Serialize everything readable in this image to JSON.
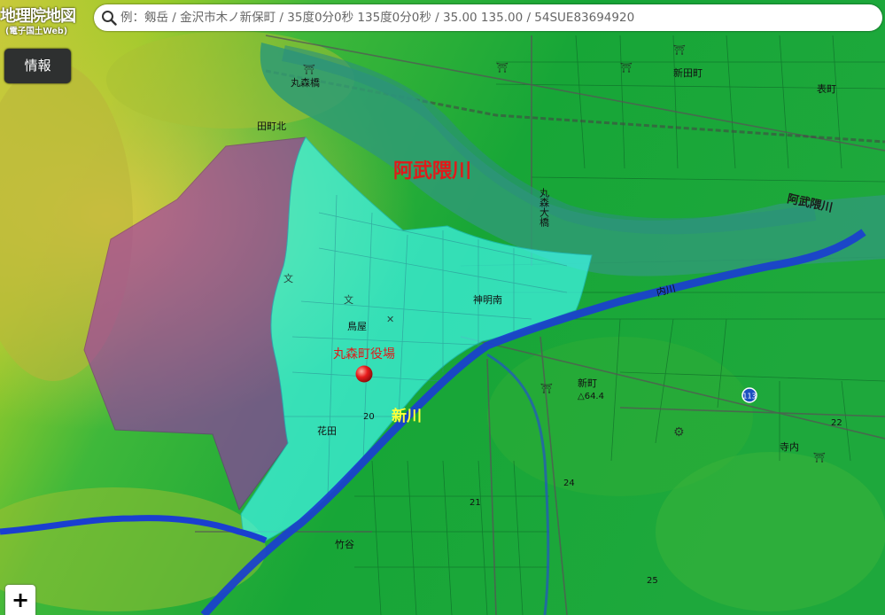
{
  "header": {
    "logo_main": "地理院地図",
    "logo_sub": "(電子国土Web)",
    "search_placeholder": "例：剱岳 / 金沢市木ノ新保町 / 35度0分0秒 135度0分0秒 / 35.00 135.00 / 54SUE83694920"
  },
  "controls": {
    "info_label": "情報",
    "zoom_in_label": "+"
  },
  "map": {
    "labels": {
      "river_large": "阿武隈川",
      "river_small": "阿武隈川",
      "office": "丸森町役場",
      "shinkawa": "新川",
      "uchikawa": "内川",
      "marumori_bridge": "丸森橋",
      "marumori_ohashi": "丸森大橋",
      "shinden": "新田町",
      "omote": "表町",
      "jinmei": "神明南",
      "torii": "鳥屋",
      "hanada": "花田",
      "takeya": "竹谷",
      "shinmachi": "新町",
      "terauchi": "寺内",
      "tamachi": "田町北",
      "height_main": "64.4",
      "n22": "22",
      "n24": "24",
      "n25": "25",
      "n20": "20",
      "n21": "21",
      "route": "113"
    },
    "colors": {
      "river": "#1a3fd0",
      "purple_zone": "#a02ab4",
      "cyan_zone": "#3ff5e8",
      "office_marker": "#e81b1b",
      "label_red": "#e01a1a",
      "label_yellow": "#ffff3a"
    }
  }
}
